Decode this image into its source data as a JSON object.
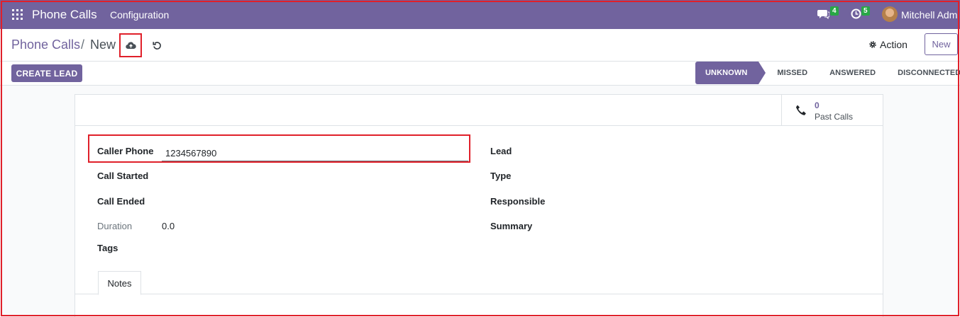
{
  "topbar": {
    "app_title": "Phone Calls",
    "menu_configuration": "Configuration",
    "chat_badge": "4",
    "activity_badge": "5",
    "user_name": "Mitchell Admi"
  },
  "breadcrumb": {
    "parent": "Phone Calls",
    "separator": "/",
    "current": "New"
  },
  "control": {
    "action_label": "Action",
    "new_label": "New"
  },
  "header": {
    "create_lead_label": "CREATE LEAD",
    "stages": [
      "UNKNOWN",
      "MISSED",
      "ANSWERED",
      "DISCONNECTED"
    ],
    "active_stage": "UNKNOWN"
  },
  "stat_button": {
    "value": "0",
    "label": "Past Calls"
  },
  "form": {
    "caller_phone_label": "Caller Phone",
    "caller_phone_value": "1234567890",
    "call_started_label": "Call Started",
    "call_ended_label": "Call Ended",
    "duration_label": "Duration",
    "duration_value": "0.0",
    "tags_label": "Tags",
    "lead_label": "Lead",
    "type_label": "Type",
    "responsible_label": "Responsible",
    "summary_label": "Summary"
  },
  "notebook": {
    "notes_tab": "Notes"
  },
  "colors": {
    "brand": "#71639e",
    "badge": "#28a745",
    "highlight": "#e0202a"
  }
}
